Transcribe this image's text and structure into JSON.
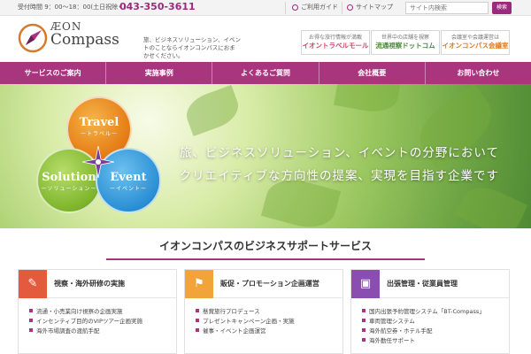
{
  "topbar": {
    "hours": "受付時間 9：00〜18：00(土日祝除く)",
    "phone": "043-350-3611",
    "guide_label": "ご利用ガイド",
    "sitemap_label": "サイトマップ",
    "search_placeholder": "サイト内検索",
    "search_button": "検索"
  },
  "header": {
    "logo_line1": "ÆON",
    "logo_line2": "Compass",
    "tagline": "旅、ビジネスソリューション、イベントのことならイオンコンパスにおまかせください。",
    "links": [
      {
        "sub": "お得な旅行情報が満載",
        "main": "イオントラベルモール"
      },
      {
        "sub": "世界中の店舗を視察",
        "main": "流通視察ドットコム"
      },
      {
        "sub": "会議室や会議運営は",
        "main": "イオンコンパス会議室"
      }
    ]
  },
  "nav": [
    "サービスのご案内",
    "実施事例",
    "よくあるご質問",
    "会社概要",
    "お問い合わせ"
  ],
  "hero": {
    "circles": {
      "travel": {
        "title": "Travel",
        "sub": "ートラベルー"
      },
      "solution": {
        "title": "Solution",
        "sub": "ーソリューションー"
      },
      "event": {
        "title": "Event",
        "sub": "ーイベントー"
      }
    },
    "caption_line1": "旅、ビジネスソリューション、イベントの分野において",
    "caption_line2": "クリエイティブな方向性の提案、実現を目指す企業です"
  },
  "services": {
    "title": "イオンコンパスのビジネスサポートサービス",
    "cards": [
      {
        "icon": "pencil-icon",
        "title": "視察・海外研修の実施",
        "items": [
          "流通・小売業向け視察の企画実施",
          "インセンティブ目的のVIPツアー企画実施",
          "海外市場調査の渡航手配"
        ]
      },
      {
        "icon": "flag-icon",
        "title": "販促・プロモーション企画運営",
        "items": [
          "懸賞旅行プロデュース",
          "プレゼントキャンペーン企画・実施",
          "催事・イベント企画運営"
        ]
      },
      {
        "icon": "suitcase-icon",
        "title": "出張管理・従業員管理",
        "items": [
          "国内出張予約管理システム「BT-Compass」",
          "車両管理システム",
          "海外航空券・ホテル手配",
          "海外勤任サポート"
        ]
      }
    ]
  },
  "colors": {
    "brand": "#a9357f",
    "phone": "#9b2a7c"
  }
}
